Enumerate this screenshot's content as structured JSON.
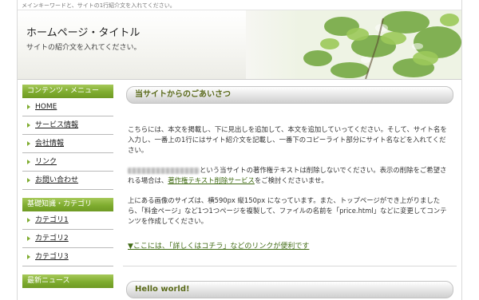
{
  "header": {
    "tagline": "メインキーワードと、サイトの1行紹介文を入れてください。",
    "site_title": "ホームページ・タイトル",
    "site_description": "サイトの紹介文を入れてください。"
  },
  "sidebar": {
    "contents_heading": "コンテンツ・メニュー",
    "contents_items": [
      {
        "label": "HOME"
      },
      {
        "label": "サービス情報"
      },
      {
        "label": "会社情報"
      },
      {
        "label": "リンク"
      },
      {
        "label": "お問い合わせ"
      }
    ],
    "category_heading": "基礎知識・カテゴリ",
    "category_items": [
      {
        "label": "カテゴリ1"
      },
      {
        "label": "カテゴリ2"
      },
      {
        "label": "カテゴリ3"
      }
    ],
    "news_heading": "最新ニュース"
  },
  "main": {
    "greeting_title": "当サイトからのごあいさつ",
    "para1": "こちらには、本文を掲載し、下に見出しを追加して、本文を追加していってください。そして、サイト名を入力し、一番上の1行にはサイト紹介文を記載し、一番下のコピーライト部分にサイト名などを入れてください。",
    "para2_after_blur": "という当サイトの著作権テキストは削除しないでください。表示の削除をご希望される場合は、",
    "para2_link": "著作権テキスト削除サービス",
    "para2_end": "をご検討くださいませ。",
    "para3": "上にある画像のサイズは、横590px 縦150px になっています。また、トップページができ上がりましたら、「料金ページ」など1つ1つページを複製して、ファイルの名前を「price.html」などに変更してコンテンツを作成してください。",
    "more_link": "▼ここには、「詳しくはコチラ」などのリンクが便利です",
    "post_title": "Hello world!"
  },
  "colors": {
    "accent_green": "#7fac2f",
    "link_green": "#3f6a12",
    "title_olive": "#5a6a1a"
  }
}
